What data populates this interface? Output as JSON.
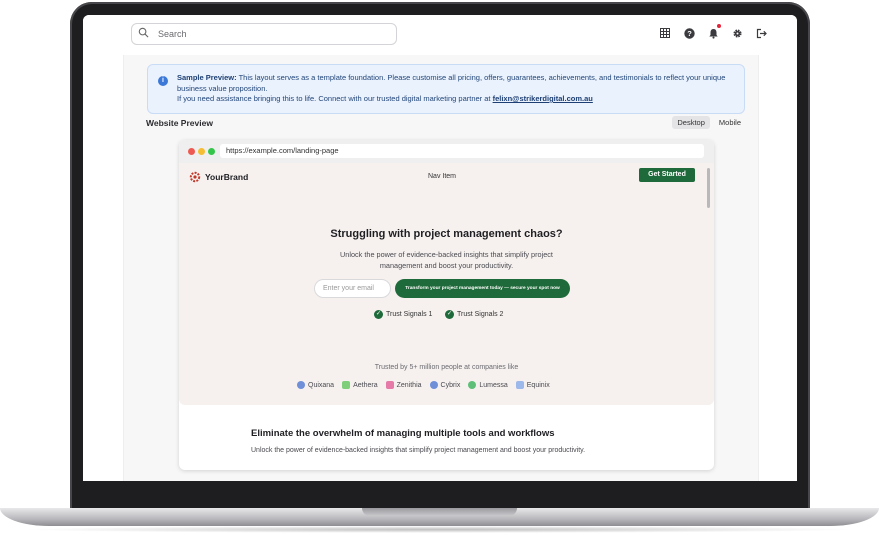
{
  "search": {
    "placeholder": "Search"
  },
  "topbar_icons": [
    "grid-icon",
    "help-icon",
    "bell-icon",
    "gear-icon",
    "logout-icon"
  ],
  "notice": {
    "label": "Sample Preview:",
    "text": " This layout serves as a template foundation. Please customise all pricing, offers, guarantees, achievements, and testimonials to reflect your unique business value proposition.",
    "line2_prefix": "If you need assistance bringing this to life. Connect with our trusted digital marketing partner at ",
    "email": "felixn@strikerdigital.com.au"
  },
  "preview": {
    "title": "Website Preview",
    "modes": [
      "Desktop",
      "Mobile"
    ],
    "active_mode": "Desktop"
  },
  "browser": {
    "url": "https://example.com/landing-page",
    "brand": "YourBrand",
    "nav_item": "Nav Item",
    "cta_top": "Get Started",
    "headline": "Struggling with project management chaos?",
    "subhead": "Unlock the power of evidence-backed insights that simplify project management and boost your productivity.",
    "email_placeholder": "Enter your email",
    "cta_main": "Transform your project management today — secure your spot now",
    "trust_signals": [
      "Trust Signals 1",
      "Trust Signals 2"
    ],
    "trusted_by": "Trusted by 5+ million people at companies like",
    "companies": [
      {
        "name": "Quixana",
        "color": "#6f8fd9"
      },
      {
        "name": "Aethera",
        "color": "#7fcf7a"
      },
      {
        "name": "Zenithia",
        "color": "#e57aa8"
      },
      {
        "name": "Cybrix",
        "color": "#6f8fd9"
      },
      {
        "name": "Lumessa",
        "color": "#5fbf78"
      },
      {
        "name": "Equinix",
        "color": "#9db8ea"
      }
    ],
    "section2_title": "Eliminate the overwhelm of managing multiple tools and workflows",
    "section2_text": "Unlock the power of evidence-backed insights that simplify project management and boost your productivity."
  },
  "colors": {
    "brand_green": "#1f6a3a",
    "notice_bg": "#eaf2fd",
    "hero_bg": "#f6f1ef"
  }
}
